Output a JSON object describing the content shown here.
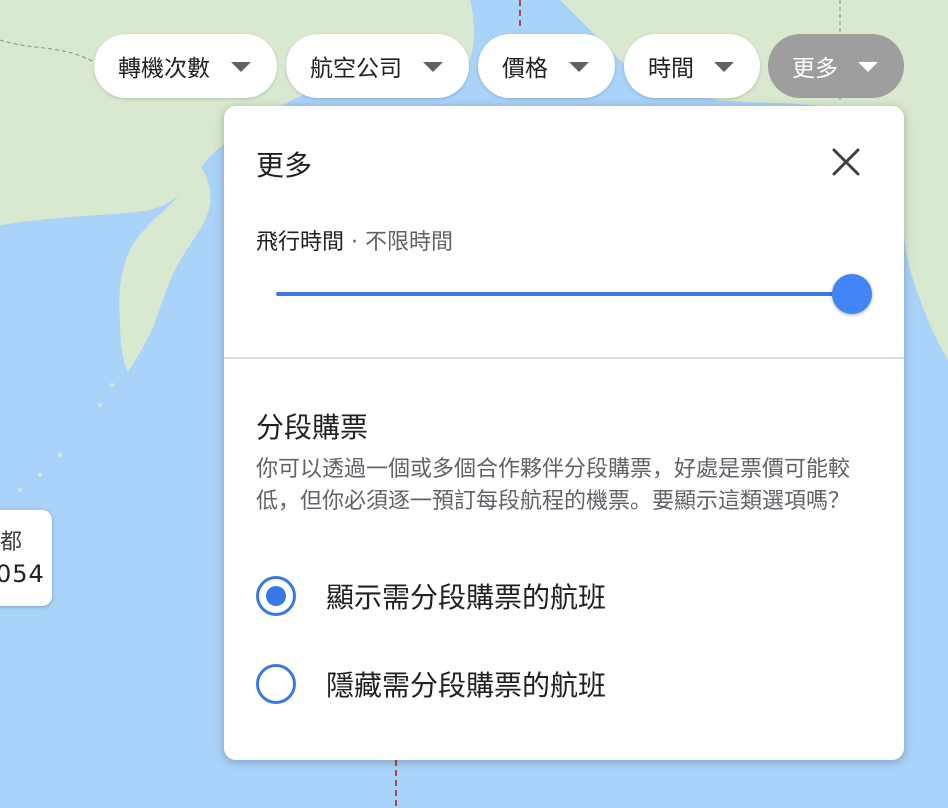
{
  "filters": [
    {
      "label": "轉機次數",
      "active": false
    },
    {
      "label": "航空公司",
      "active": false
    },
    {
      "label": "價格",
      "active": false
    },
    {
      "label": "時間",
      "active": false
    },
    {
      "label": "更多",
      "active": true
    }
  ],
  "map_marker": {
    "city": "都",
    "price": "054"
  },
  "more_panel": {
    "title": "更多",
    "duration": {
      "label": "飛行時間",
      "separator": " · ",
      "value": "不限時間",
      "slider_fraction": 1.0
    },
    "separate_tickets": {
      "title": "分段購票",
      "description": "你可以透過一個或多個合作夥伴分段購票，好處是票價可能較低，但你必須逐一預訂每段航程的機票。要顯示這類選項嗎？",
      "options": [
        {
          "label": "顯示需分段購票的航班",
          "checked": true
        },
        {
          "label": "隱藏需分段購票的航班",
          "checked": false
        }
      ]
    }
  },
  "colors": {
    "accent": "#4285f4",
    "active_chip": "#9e9e9e",
    "ocean": "#aad3f9",
    "land": "#d8e8cf"
  }
}
